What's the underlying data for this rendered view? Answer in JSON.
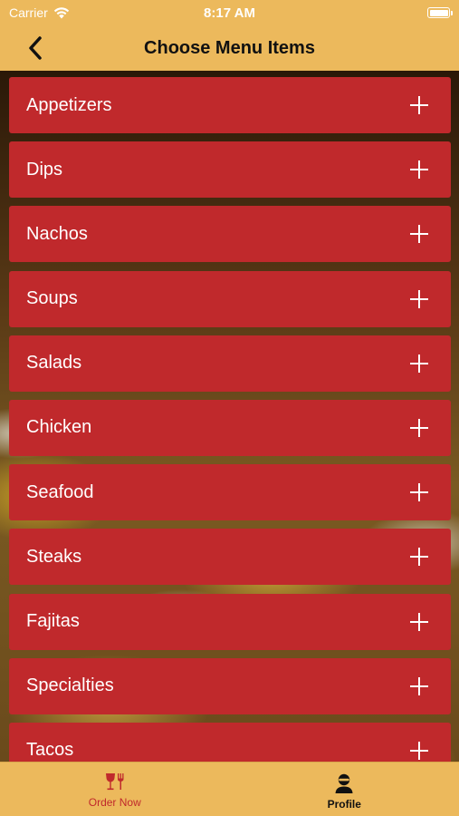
{
  "status_bar": {
    "carrier": "Carrier",
    "time": "8:17 AM"
  },
  "nav": {
    "title": "Choose Menu Items",
    "back_icon": "chevron-left-icon"
  },
  "menu": {
    "items": [
      {
        "label": "Appetizers"
      },
      {
        "label": "Dips"
      },
      {
        "label": "Nachos"
      },
      {
        "label": "Soups"
      },
      {
        "label": "Salads"
      },
      {
        "label": "Chicken"
      },
      {
        "label": "Seafood"
      },
      {
        "label": "Steaks"
      },
      {
        "label": "Fajitas"
      },
      {
        "label": "Specialties"
      },
      {
        "label": "Tacos"
      }
    ],
    "expand_icon": "plus-icon"
  },
  "tab_bar": {
    "tabs": [
      {
        "label": "Order Now",
        "icon": "wine-fork-icon",
        "color": "#c0292c"
      },
      {
        "label": "Profile",
        "icon": "profile-icon",
        "color": "#111111"
      }
    ]
  },
  "colors": {
    "header": "#ecb95c",
    "menu_item": "#c0292c"
  }
}
